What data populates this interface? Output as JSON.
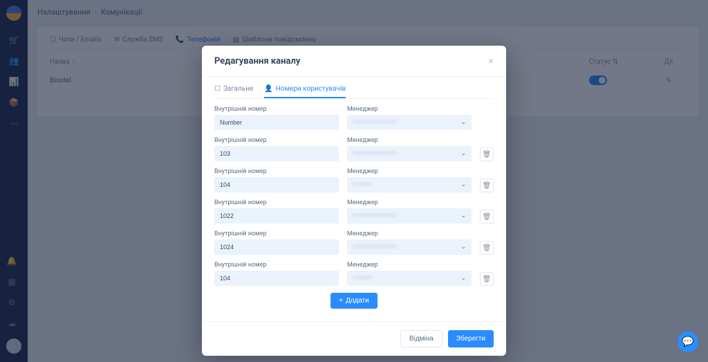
{
  "breadcrumb": {
    "root": "Налаштування",
    "current": "Комунікації"
  },
  "page_tabs": [
    {
      "label": "Чати / Emails",
      "active": false
    },
    {
      "label": "Служба SMS",
      "active": false
    },
    {
      "label": "Телефонія",
      "active": true
    },
    {
      "label": "Шаблони повідомлень",
      "active": false
    }
  ],
  "table": {
    "header_name": "Назва",
    "header_status": "Статус",
    "header_actions": "Дії",
    "row_name": "Binotel"
  },
  "modal": {
    "title": "Редагування каналу",
    "tab_general": "Загальне",
    "tab_users": "Номери користувачів",
    "label_extension": "Внутрішній номер",
    "label_manager": "Менеджер",
    "rows": [
      {
        "ext": "Number",
        "manager": "—————————",
        "deletable": false
      },
      {
        "ext": "103",
        "manager": "—————————",
        "deletable": true
      },
      {
        "ext": "104",
        "manager": "————",
        "deletable": true
      },
      {
        "ext": "1022",
        "manager": "—————————",
        "deletable": true
      },
      {
        "ext": "1024",
        "manager": "—————————",
        "deletable": true
      },
      {
        "ext": "104",
        "manager": "————",
        "deletable": true
      }
    ],
    "add_label": "Додати",
    "cancel_label": "Відміна",
    "save_label": "Зберегти"
  }
}
